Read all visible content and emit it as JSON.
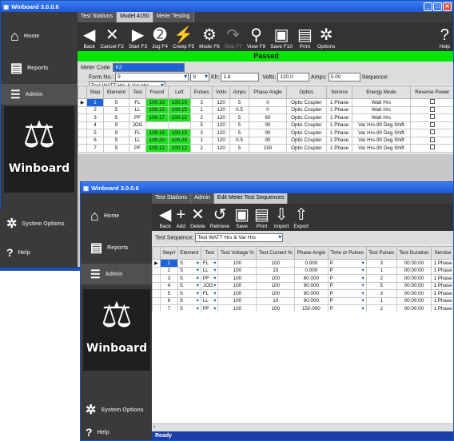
{
  "win1": {
    "title": "Winboard 3.0.0.6",
    "tabs": [
      "Test Stations",
      "Model 4150",
      "Meter Testing"
    ],
    "sidebar": [
      {
        "icon": "home-icon",
        "label": "Home"
      },
      {
        "icon": "reports-icon",
        "label": "Reports"
      },
      {
        "icon": "admin-icon",
        "label": "Admin"
      }
    ],
    "toolbar": [
      {
        "icon": "back-icon",
        "glyph": "◀",
        "label": "Back",
        "disabled": false
      },
      {
        "icon": "cancel-icon",
        "glyph": "✕",
        "label": "Cancel F2",
        "disabled": false
      },
      {
        "icon": "start-icon",
        "glyph": "▶",
        "label": "Start F3",
        "disabled": false
      },
      {
        "icon": "jog-icon",
        "glyph": "➋",
        "label": "Jog F4",
        "disabled": false
      },
      {
        "icon": "creep-icon",
        "glyph": "⚡",
        "label": "Creep F5",
        "disabled": false
      },
      {
        "icon": "mode-icon",
        "glyph": "⚙",
        "label": "Mode F6",
        "disabled": false
      },
      {
        "icon": "skip-icon",
        "glyph": "↷",
        "label": "Skip F7",
        "disabled": true
      },
      {
        "icon": "view-icon",
        "glyph": "⚲",
        "label": "View F9",
        "disabled": false
      },
      {
        "icon": "save-icon",
        "glyph": "▣",
        "label": "Save F10",
        "disabled": false
      },
      {
        "icon": "print-icon",
        "glyph": "▤",
        "label": "Print",
        "disabled": false
      },
      {
        "icon": "options-icon",
        "glyph": "✲",
        "label": "Options",
        "disabled": false
      }
    ],
    "help_label": "Help",
    "status": "Passed",
    "status_color": "#00e600",
    "meter_code_label": "Meter Code:",
    "meter_code": "K2",
    "form_no_label": "Form No.:",
    "form_no": "9",
    "form_suffix": "S",
    "kh_label": "Kh:",
    "kh": "1.8",
    "volts_label": "Volts:",
    "volts": "120.0",
    "amps_label": "Amps:",
    "amps": "5.00",
    "sequence_label": "Sequence:",
    "sequence": "Test WATT Hrs & Var Hrs",
    "columns": [
      "Step",
      "Element",
      "Test",
      "Found",
      "Left",
      "Pulses",
      "Volts",
      "Amps",
      "Phase Angle",
      "Optics",
      "Service",
      "Energy Mode",
      "Reverse Power"
    ],
    "rows": [
      [
        "1",
        "S",
        "FL",
        "100.10",
        "100.10",
        "3",
        "120",
        "5",
        "0",
        "Optic Coupler",
        "1 Phase",
        "Watt Hrs"
      ],
      [
        "2",
        "S",
        "LL",
        "100.15",
        "100.15",
        "1",
        "120",
        "0.5",
        "0",
        "Optic Coupler",
        "1 Phase",
        "Watt Hrs"
      ],
      [
        "3",
        "S",
        "PF",
        "100.17",
        "100.12",
        "2",
        "120",
        "5",
        "60",
        "Optic Coupler",
        "1 Phase",
        "Watt Hrs"
      ],
      [
        "4",
        "S",
        "JOG",
        "",
        "",
        "5",
        "120",
        "5",
        "90",
        "Optic Coupler",
        "1 Phase",
        "Var Hrs-90 Deg Shift"
      ],
      [
        "5",
        "S",
        "FL",
        "100.15",
        "100.15",
        "3",
        "120",
        "5",
        "90",
        "Optic Coupler",
        "1 Phase",
        "Var Hrs-90 Deg Shift"
      ],
      [
        "6",
        "S",
        "LL",
        "100.20",
        "100.20",
        "1",
        "120",
        "0.5",
        "90",
        "Optic Coupler",
        "1 Phase",
        "Var Hrs-90 Deg Shift"
      ],
      [
        "7",
        "S",
        "PF",
        "100.12",
        "100.12",
        "2",
        "120",
        "5",
        "150",
        "Optic Coupler",
        "1 Phase",
        "Var Hrs-90 Deg Shift"
      ]
    ],
    "logo": "Winboard",
    "system_options": "System Options",
    "help_side": "Help"
  },
  "win2": {
    "title": "Winboard 3.0.0.6",
    "tabs": [
      "Test Stations",
      "Admin",
      "Edit Meter Test Sequences"
    ],
    "sidebar": [
      {
        "icon": "home-icon",
        "label": "Home"
      },
      {
        "icon": "reports-icon",
        "label": "Reports"
      },
      {
        "icon": "admin-icon",
        "label": "Admin"
      }
    ],
    "toolbar": [
      {
        "icon": "back-icon",
        "glyph": "◀",
        "label": "Back",
        "disabled": false
      },
      {
        "icon": "add-icon",
        "glyph": "+",
        "label": "Add",
        "disabled": false
      },
      {
        "icon": "delete-icon",
        "glyph": "✕",
        "label": "Delete",
        "disabled": false
      },
      {
        "icon": "retrieve-icon",
        "glyph": "↺",
        "label": "Retrieve",
        "disabled": false
      },
      {
        "icon": "save-icon",
        "glyph": "▣",
        "label": "Save",
        "disabled": false
      },
      {
        "icon": "print-icon",
        "glyph": "▤",
        "label": "Print",
        "disabled": false
      },
      {
        "icon": "import-icon",
        "glyph": "⇩",
        "label": "Import",
        "disabled": false
      },
      {
        "icon": "export-icon",
        "glyph": "⇧",
        "label": "Export",
        "disabled": false
      }
    ],
    "sequence_label": "Test Sequence:",
    "sequence": "Test WATT Hrs & Var Hrs",
    "columns": [
      "Step#",
      "Element",
      "Test",
      "Test Voltage %",
      "Test Current %",
      "Phase Angle",
      "Time or Pulses",
      "Test Pulses",
      "Test Duration",
      "Service"
    ],
    "rows": [
      [
        "1",
        "S",
        "FL",
        "100",
        "100",
        "0.000",
        "P",
        "3",
        "00:00:00",
        "1 Phase"
      ],
      [
        "2",
        "S",
        "LL",
        "100",
        "10",
        "0.000",
        "P",
        "1",
        "00:00:00",
        "1 Phase"
      ],
      [
        "3",
        "S",
        "PF",
        "100",
        "100",
        "60.000",
        "P",
        "2",
        "00:00:00",
        "1 Phase"
      ],
      [
        "4",
        "S",
        "JOG",
        "100",
        "100",
        "90.000",
        "P",
        "5",
        "00:00:00",
        "1 Phase"
      ],
      [
        "5",
        "S",
        "FL",
        "100",
        "100",
        "90.000",
        "P",
        "3",
        "00:00:00",
        "1 Phase"
      ],
      [
        "6",
        "S",
        "LL",
        "100",
        "10",
        "90.000",
        "P",
        "1",
        "00:00:00",
        "1 Phase"
      ],
      [
        "7",
        "S",
        "PF",
        "100",
        "100",
        "150.000",
        "P",
        "2",
        "00:00:00",
        "1 Phase"
      ]
    ],
    "logo": "Winboard",
    "system_options": "System Options",
    "help_side": "Help",
    "status_bar": "Ready"
  }
}
